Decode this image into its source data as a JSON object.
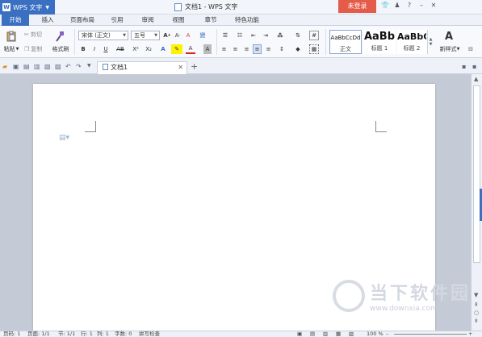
{
  "app": {
    "name": "WPS 文字",
    "logo": "W"
  },
  "window": {
    "title": "文档1 - WPS 文字"
  },
  "title_bar": {
    "login_label": "未登录",
    "icons": [
      "shirt-icon",
      "user-icon",
      "help-icon",
      "minimize-icon",
      "close-icon"
    ],
    "glyphs": [
      "👕",
      "♟",
      "?",
      "–",
      "✕"
    ]
  },
  "ribbon_tabs": [
    "开始",
    "插入",
    "页面布局",
    "引用",
    "审阅",
    "视图",
    "章节",
    "特色功能"
  ],
  "ribbon": {
    "paste_label": "粘贴",
    "cut_label": "剪切",
    "copy_label": "复制",
    "format_painter_label": "格式刷",
    "font_name": "宋体 (正文)",
    "font_size": "五号",
    "bold": "B",
    "italic": "I",
    "underline": "U",
    "strike": "AB",
    "superscript": "X²",
    "subscript": "X₂",
    "styles": [
      {
        "preview": "AaBbCcDd",
        "label": "正文"
      },
      {
        "preview": "AaBb",
        "label": "标题 1"
      },
      {
        "preview": "AaBbC",
        "label": "标题 2"
      }
    ],
    "new_style_label": "新样式"
  },
  "document_tab": {
    "label": "文档1"
  },
  "status_bar": {
    "page": "页码: 1",
    "pages": "页面: 1/1",
    "section": "节: 1/1",
    "row": "行: 1",
    "col": "列: 1",
    "words": "字数: 0",
    "spell": "拼写检查",
    "zoom": "100 %"
  },
  "watermark": {
    "text": "当下软件园",
    "url": "www.downxia.com"
  },
  "colors": {
    "accent": "#3b6fc2",
    "login": "#e45b4a",
    "workspace": "#c5cbd6"
  }
}
